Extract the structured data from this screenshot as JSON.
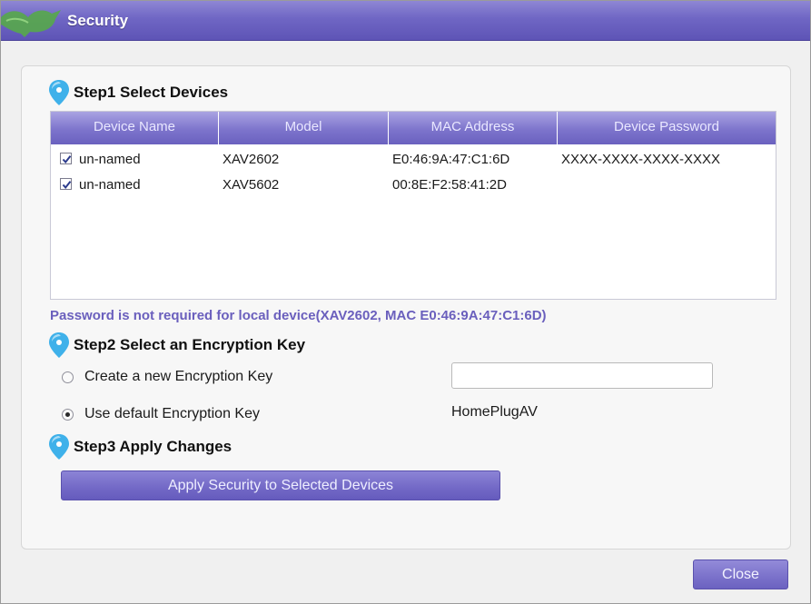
{
  "window": {
    "title": "Security",
    "accent_color": "#6f66c4",
    "logo_icon": "genie-lamp-icon"
  },
  "step1": {
    "label": "Step1 Select Devices",
    "icon": "location-pin-icon",
    "table": {
      "columns": [
        "Device Name",
        "Model",
        "MAC Address",
        "Device Password"
      ],
      "rows": [
        {
          "checked": true,
          "name": "un-named",
          "model": "XAV2602",
          "mac": "E0:46:9A:47:C1:6D",
          "password": "XXXX-XXXX-XXXX-XXXX"
        },
        {
          "checked": true,
          "name": "un-named",
          "model": "XAV5602",
          "mac": "00:8E:F2:58:41:2D",
          "password": ""
        }
      ]
    },
    "note": "Password is not required for local device(XAV2602, MAC E0:46:9A:47:C1:6D)"
  },
  "step2": {
    "label": "Step2 Select an Encryption Key",
    "icon": "location-pin-icon",
    "options": [
      {
        "label": "Create a new Encryption Key",
        "selected": false
      },
      {
        "label": "Use default Encryption Key",
        "selected": true
      }
    ],
    "new_key_value": "",
    "default_key": "HomePlugAV"
  },
  "step3": {
    "label": "Step3 Apply Changes",
    "icon": "location-pin-icon",
    "apply_button": "Apply Security to Selected Devices"
  },
  "footer": {
    "close_button": "Close"
  }
}
